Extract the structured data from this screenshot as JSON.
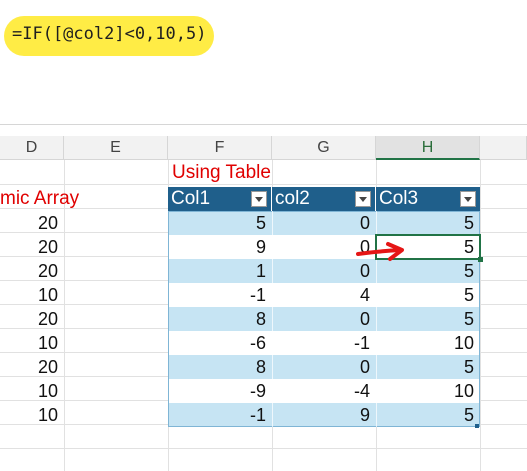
{
  "formula": {
    "text": "=IF([@col2]<0,10,5)"
  },
  "columns": [
    {
      "id": "D",
      "label": "D"
    },
    {
      "id": "E",
      "label": "E"
    },
    {
      "id": "F",
      "label": "F"
    },
    {
      "id": "G",
      "label": "G"
    },
    {
      "id": "H",
      "label": "H"
    }
  ],
  "titles": {
    "using_table": "Using Table",
    "dynamic_array": "mic Array"
  },
  "table": {
    "headers": [
      "Col1",
      "col2",
      "Col3"
    ],
    "rows": [
      {
        "d": "20",
        "col1": "5",
        "col2": "0",
        "col3": "5"
      },
      {
        "d": "20",
        "col1": "9",
        "col2": "0",
        "col3": "5"
      },
      {
        "d": "20",
        "col1": "1",
        "col2": "0",
        "col3": "5"
      },
      {
        "d": "10",
        "col1": "-1",
        "col2": "4",
        "col3": "5"
      },
      {
        "d": "20",
        "col1": "8",
        "col2": "0",
        "col3": "5"
      },
      {
        "d": "10",
        "col1": "-6",
        "col2": "-1",
        "col3": "10"
      },
      {
        "d": "20",
        "col1": "8",
        "col2": "0",
        "col3": "5"
      },
      {
        "d": "10",
        "col1": "-9",
        "col2": "-4",
        "col3": "10"
      },
      {
        "d": "10",
        "col1": "-1",
        "col2": "9",
        "col3": "5"
      }
    ]
  },
  "colors": {
    "table_header": "#1f5f8b",
    "band": "#c6e4f3",
    "accent": "#217346",
    "title_red": "#e00000",
    "highlighter": "#ffeb3b"
  }
}
